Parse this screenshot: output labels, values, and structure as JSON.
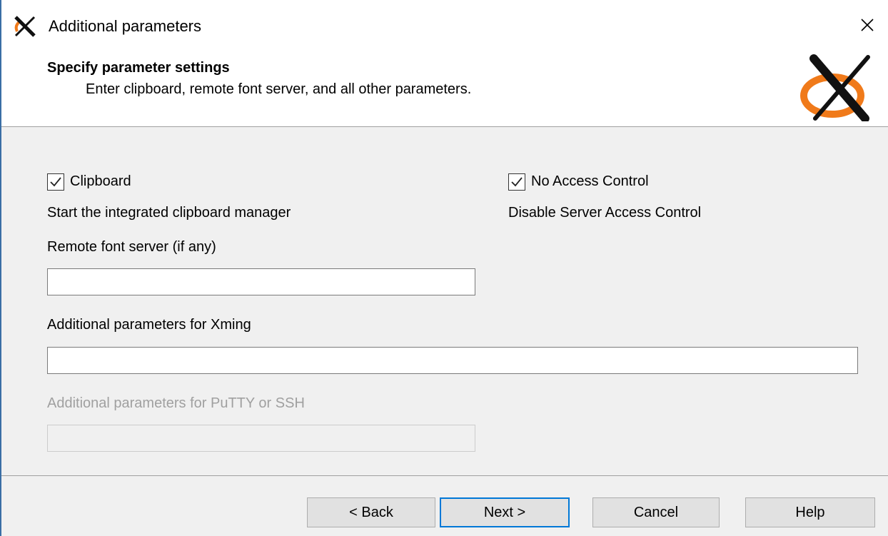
{
  "window": {
    "title": "Additional parameters",
    "title_icon": "xming-x-icon",
    "close_icon": "close-icon"
  },
  "header": {
    "title": "Specify parameter settings",
    "subtitle": "Enter clipboard, remote font server, and all other parameters.",
    "logo_icon": "xming-logo-icon"
  },
  "options": {
    "clipboard": {
      "label": "Clipboard",
      "checked": true,
      "description": "Start the integrated clipboard manager"
    },
    "no_access_control": {
      "label": "No Access Control",
      "checked": true,
      "description": "Disable Server Access Control"
    }
  },
  "fields": {
    "remote_font_server": {
      "label": "Remote font server (if any)",
      "value": "",
      "enabled": true
    },
    "xming_params": {
      "label": "Additional parameters for Xming",
      "value": "",
      "enabled": true
    },
    "putty_params": {
      "label": "Additional parameters for PuTTY or SSH",
      "value": "",
      "enabled": false
    }
  },
  "buttons": {
    "back": "< Back",
    "next": "Next >",
    "cancel": "Cancel",
    "help": "Help"
  },
  "colors": {
    "accent": "#0078d7",
    "logo_orange": "#f07a1a",
    "disabled_text": "#a0a0a0"
  }
}
